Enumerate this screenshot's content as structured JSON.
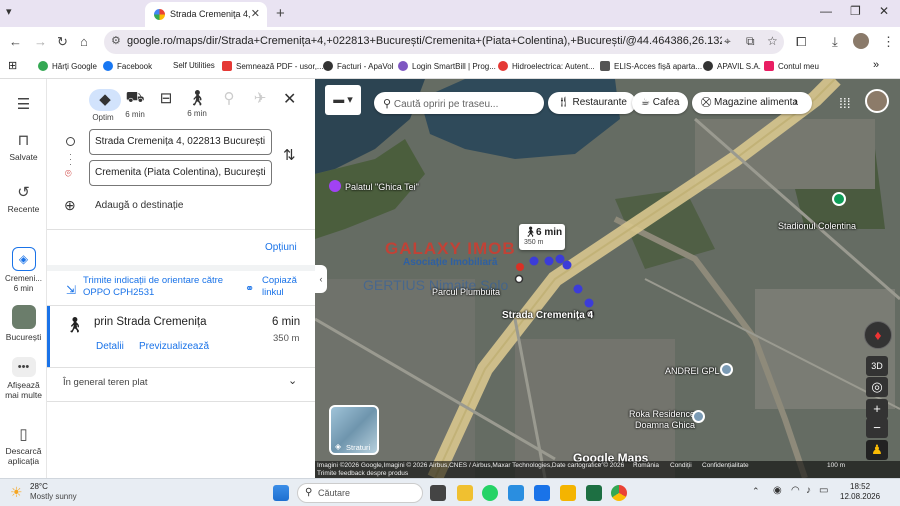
{
  "browser": {
    "tab_title": "Strada Cremeniţa 4, 02…",
    "url": "google.ro/maps/dir/Strada+Cremenița+4,+022813+București/Cremenita+(Piata+Colentina),+București/@44.464386,26.1322753,1040m/data=!..."
  },
  "bookmarks": [
    {
      "label": "Hărți Google",
      "color": "#34a853"
    },
    {
      "label": "Facebook",
      "color": "#1877f2"
    },
    {
      "label": "Self Utilities",
      "color": "#ffffff"
    },
    {
      "label": "Semnează PDF - usor,...",
      "color": "#e53935"
    },
    {
      "label": "Facturi - ApaVol",
      "color": "#333333"
    },
    {
      "label": "Login SmartBill | Prog...",
      "color": "#7e57c2"
    },
    {
      "label": "Hidroelectrica: Autent...",
      "color": "#e53935"
    },
    {
      "label": "ELIS-Acces fișă aparta...",
      "color": "#555555"
    },
    {
      "label": "APAVIL S.A.",
      "color": "#333333"
    },
    {
      "label": "Contul meu",
      "color": "#e91e63"
    }
  ],
  "rail": {
    "saved": "Salvate",
    "recent": "Recente",
    "item_cremenita": "Cremeni... 6 min",
    "item_bucuresti": "București",
    "more": "Afișează mai multe",
    "download": "Descarcă aplicația"
  },
  "directions": {
    "modes": [
      {
        "name": "Optim",
        "icon": "route-icon",
        "selected": true
      },
      {
        "name": "6 min",
        "icon": "car-icon"
      },
      {
        "name": "",
        "icon": "bus-icon"
      },
      {
        "name": "6 min",
        "icon": "walk-icon"
      },
      {
        "name": "",
        "icon": "bike-icon"
      },
      {
        "name": "",
        "icon": "plane-icon"
      }
    ],
    "origin": "Strada Cremenița 4, 022813 București",
    "destination": "Cremenita (Piata Colentina), București",
    "add_destination": "Adaugă o destinație",
    "options": "Opțiuni",
    "send_to": "Trimite indicații de orientare către OPPO CPH2531",
    "copy_link": "Copiază linkul",
    "route_via": "prin Strada Cremenița",
    "route_time": "6 min",
    "route_distance": "350 m",
    "details": "Detalii",
    "preview": "Previzualizează",
    "terrain": "În general teren plat"
  },
  "map": {
    "search_placeholder": "Caută opriri pe traseu...",
    "chip_restaurants": "Restaurante",
    "chip_coffee": "Cafea",
    "chip_shops": "Magazine alimenta",
    "callout_time": "6 min",
    "callout_dist": "350 m",
    "labels": {
      "palace": "Palatul \"Ghica Tei\"",
      "stadium": "Stadionul Colentina",
      "street_origin": "Strada Cremenița 4",
      "andrei": "ANDREI GPL",
      "roka": "Roka Residence Doamna Ghica",
      "park": "Parcul Plumbuita",
      "watermark_top": "GALAXY IMOB",
      "watermark_sub": "Asociație Imobiliară",
      "watermark_bottom": "GERTIUS Nimaite Solo"
    },
    "layers_label": "Straturi",
    "footer_attrib": "Imagini ©2026 Google,Imagini © 2026 Airbus,CNES / Airbus,Maxar Technologies,Date cartografice © 2026",
    "footer_sub": "Trimite feedback despre produs",
    "footer_links": [
      "România",
      "Condiții",
      "Confidențialitate"
    ],
    "scale": "100 m",
    "google_logo": "Google Maps",
    "ctl_3d": "3D"
  },
  "taskbar": {
    "temp": "28°C",
    "weather": "Mostly sunny",
    "search": "Căutare",
    "time": "18:52",
    "date": "12.08.2026"
  }
}
